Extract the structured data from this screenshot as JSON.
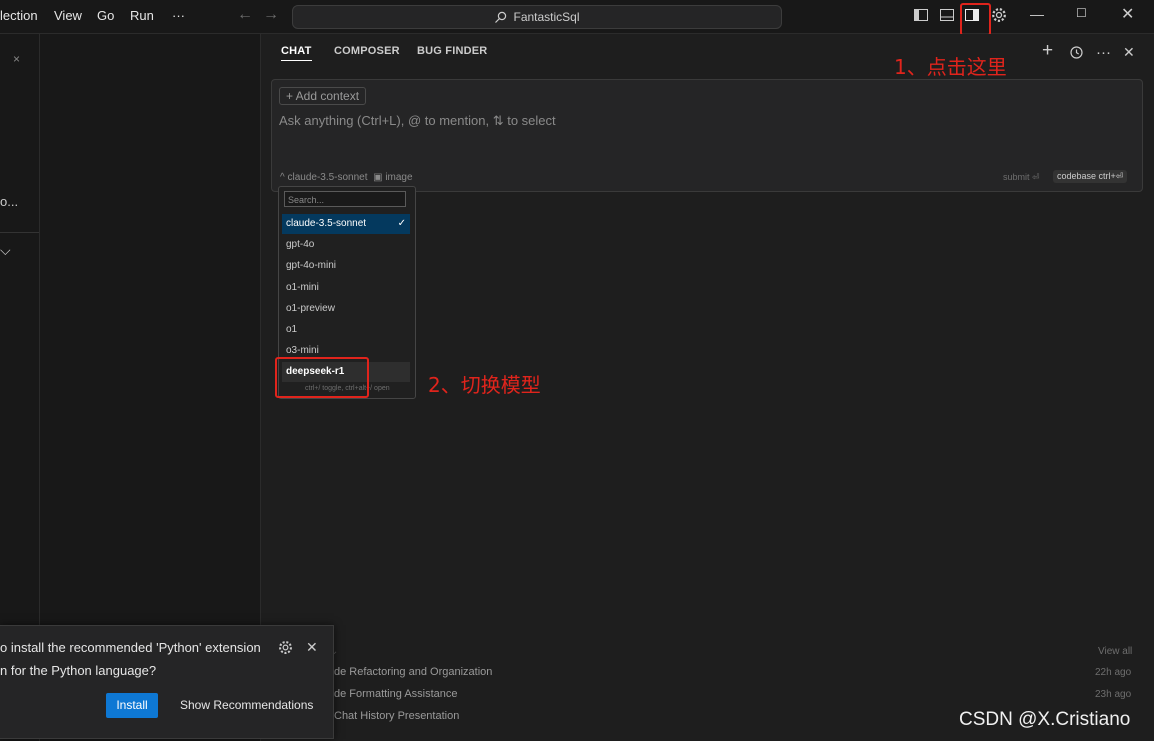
{
  "menu": [
    "lection",
    "View",
    "Go",
    "Run",
    "···"
  ],
  "search": {
    "label": "FantasticSql"
  },
  "tabs": [
    "CHAT",
    "COMPOSER",
    "BUG FINDER"
  ],
  "composer": {
    "add_context": "+ Add context",
    "placeholder": "Ask anything (Ctrl+L), @ to mention, ⇅ to select",
    "model": "^ claude-3.5-sonnet",
    "image": "▣ image",
    "submit": "submit ⏎",
    "codebase": "codebase ctrl+⏎"
  },
  "dropdown": {
    "search_placeholder": "Search...",
    "items": [
      "claude-3.5-sonnet",
      "gpt-4o",
      "gpt-4o-mini",
      "o1-mini",
      "o1-preview",
      "o1",
      "o3-mini",
      "deepseek-r1"
    ],
    "selected_index": 0,
    "hint": "ctrl+/ toggle, ctrl+alt+/ open"
  },
  "annotations": {
    "step1": "1、点击这里",
    "step2": "2、切换模型"
  },
  "history": {
    "view_all": "View all",
    "rows": [
      {
        "title": "de Refactoring and Organization",
        "time": "22h ago"
      },
      {
        "title": "de Formatting Assistance",
        "time": "23h ago"
      },
      {
        "title": "Chat History Presentation",
        "time": ""
      }
    ]
  },
  "left_panel": {
    "text_o": "o...",
    "close": "×"
  },
  "toast": {
    "line1": "o install the recommended 'Python' extension",
    "line2": "n for the Python language?",
    "install": "Install",
    "show_recommendations": "Show Recommendations"
  },
  "watermark": "CSDN @X.Cristiano"
}
